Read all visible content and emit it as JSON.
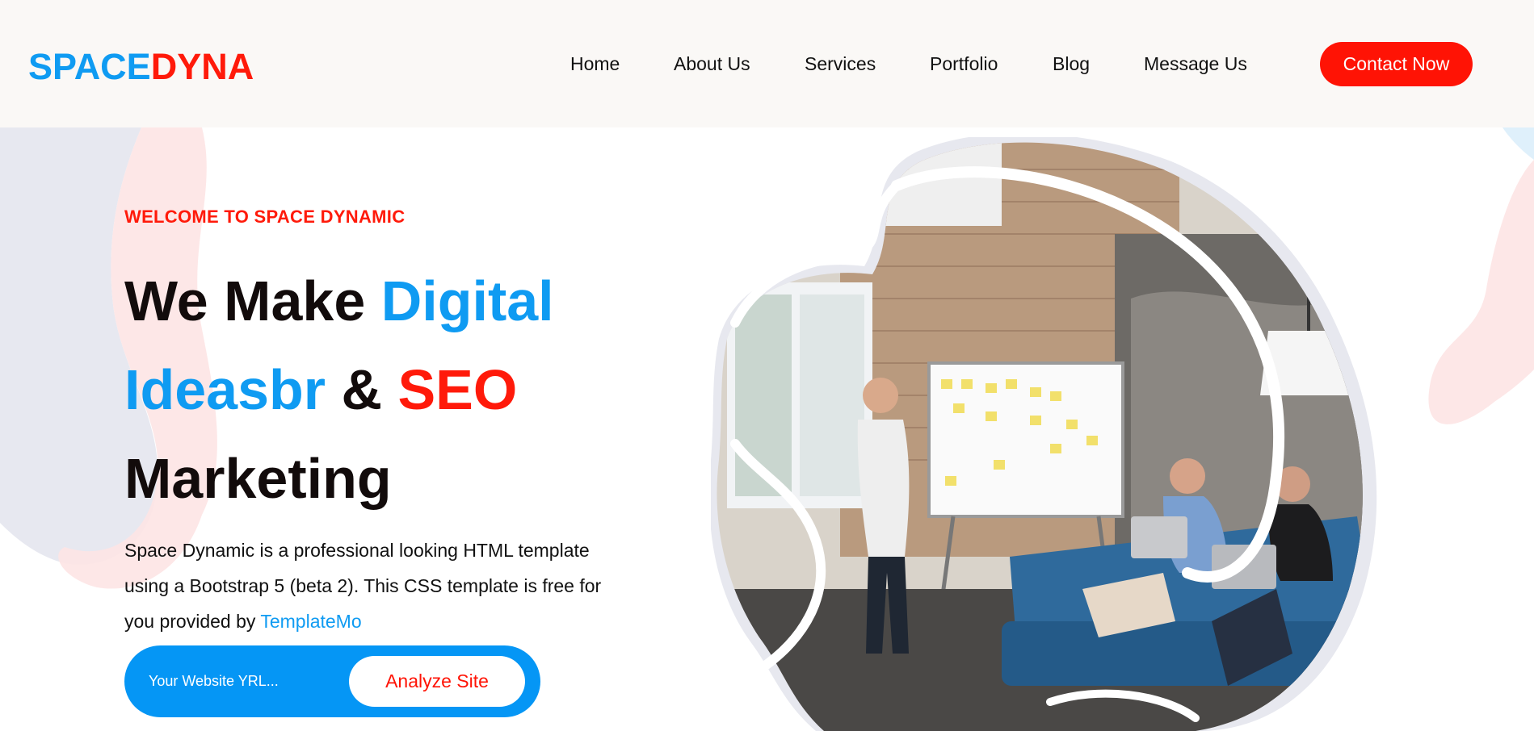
{
  "header": {
    "logo_part1": "SPACE",
    "logo_part2": "DYNA",
    "nav": [
      {
        "label": "Home"
      },
      {
        "label": "About Us"
      },
      {
        "label": "Services"
      },
      {
        "label": "Portfolio"
      },
      {
        "label": "Blog"
      },
      {
        "label": "Message Us"
      }
    ],
    "contact_label": "Contact Now"
  },
  "hero": {
    "subtitle": "WELCOME TO SPACE DYNAMIC",
    "headline": {
      "line1_a": "We Make ",
      "line1_b": "Digital",
      "line2_a": "Ideasbr",
      "line2_b": " & ",
      "line2_c": "SEO",
      "line3": "Marketing"
    },
    "description": "Space Dynamic is a professional looking HTML template using a Bootstrap 5 (beta 2). This CSS template is free for you provided by ",
    "description_link": "TemplateMo",
    "search_placeholder": "Your Website YRL...",
    "analyze_label": "Analyze Site",
    "image_icon": "team-meeting-illustration"
  },
  "colors": {
    "brand_blue": "#0f9bf2",
    "brand_red": "#ff1a0a",
    "header_bg": "#faf8f6",
    "form_blue": "#0596f5"
  }
}
